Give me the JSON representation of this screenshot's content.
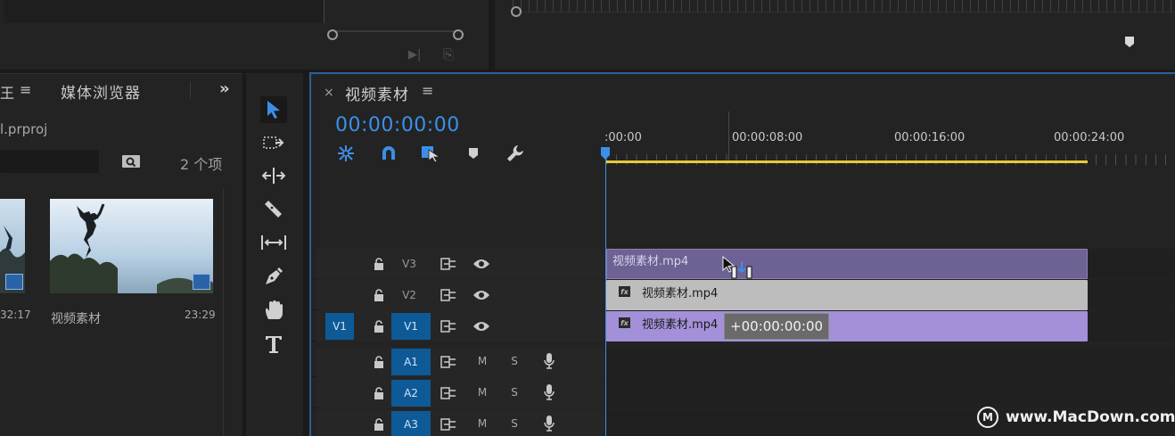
{
  "project": {
    "tab_project_partial": "王",
    "tab_menu": "≡",
    "tab_media_browser": "媒体浏览器",
    "overflow": "»",
    "project_file": "l.prproj",
    "item_count": "2 个项",
    "items": [
      {
        "duration": "32:17"
      },
      {
        "name": "视频素材",
        "duration": "23:29"
      }
    ]
  },
  "timeline": {
    "close": "×",
    "sequence_name": "视频素材",
    "menu": "≡",
    "timecode": "00:00:00:00",
    "ruler_labels": [
      ":00:00",
      "00:00:08:00",
      "00:00:16:00",
      "00:00:24:00"
    ],
    "tracks": {
      "v3": "V3",
      "v2": "V2",
      "v1": "V1",
      "v1_source": "V1",
      "a1": "A1",
      "a2": "A2",
      "a3": "A3",
      "mute": "M",
      "solo": "S"
    },
    "clips": {
      "v3": "视频素材.mp4",
      "v2": "视频素材.mp4",
      "v1": "视频素材.mp4",
      "fx": "fx"
    },
    "drag_tooltip": "+00:00:00:00"
  },
  "watermark": {
    "logo": "M",
    "text": "www.MacDown.com"
  },
  "colors": {
    "accent_blue": "#3c8fe8",
    "track_blue": "#0e5a97",
    "work_area_yellow": "#e4cc3a",
    "clip_v3_ghost": "#6e6193",
    "clip_v2_gray": "#bdbdbd",
    "clip_v1_violet": "#a390d8"
  }
}
